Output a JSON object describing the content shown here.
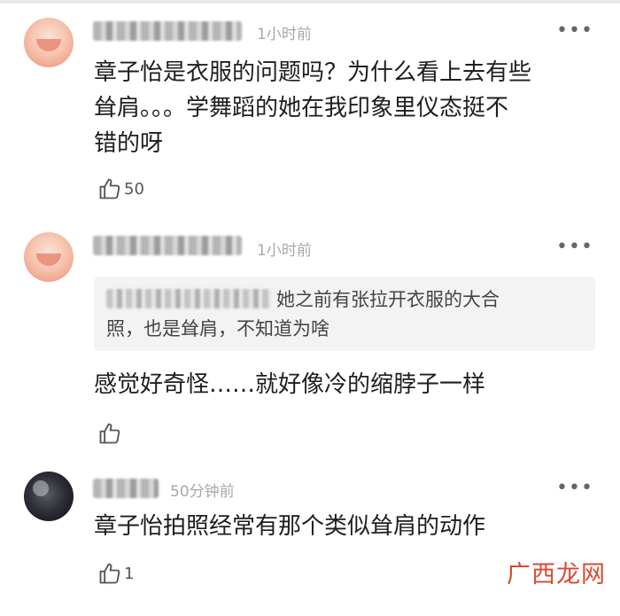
{
  "comments": [
    {
      "time": "1小时前",
      "text_lines": [
        "章子怡是衣服的问题吗？为什么看上去有些",
        "耸肩。。。学舞蹈的她在我印象里仪态挺不",
        "错的呀"
      ],
      "likes": "50",
      "more": "•••"
    },
    {
      "time": "1小时前",
      "quote_lines": [
        "她之前有张拉开衣服的大合",
        "照，也是耸肩，不知道为啥"
      ],
      "text": "感觉好奇怪……就好像冷的缩脖子一样",
      "likes": "",
      "more": "•••"
    },
    {
      "time": "50分钟前",
      "text": "章子怡拍照经常有那个类似耸肩的动作",
      "likes": "1",
      "more": "•••"
    }
  ],
  "watermark": "广西龙网"
}
